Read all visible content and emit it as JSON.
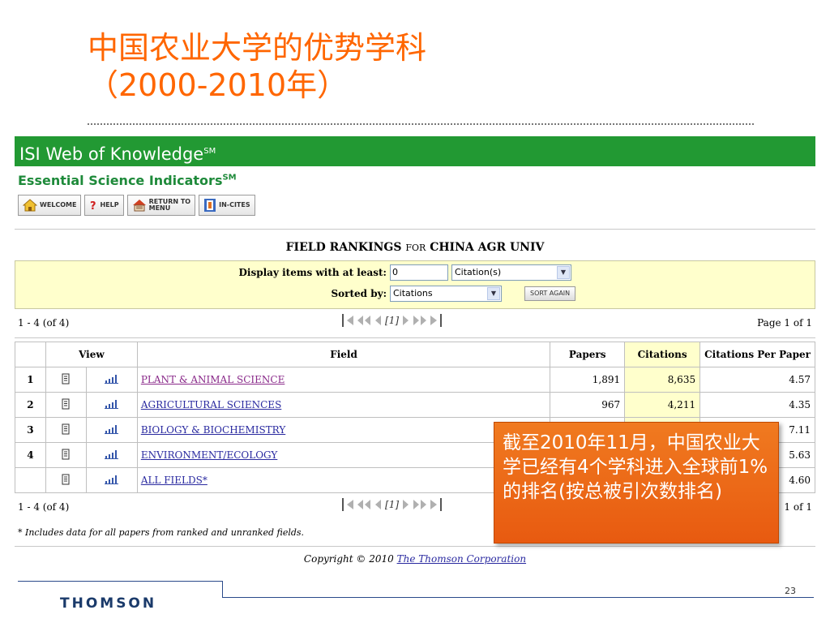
{
  "slide": {
    "title_line1": "中国农业大学的优势学科",
    "title_line2": "（2000-2010年）",
    "page_number": "23",
    "logo_text": "THOMSON"
  },
  "header": {
    "product_name": "ISI Web of Knowledge",
    "product_mark": "SM",
    "subtitle": "Essential Science Indicators",
    "subtitle_mark": "SM"
  },
  "nav": [
    {
      "label": "WELCOME",
      "icon": "home-icon"
    },
    {
      "label": "HELP",
      "icon": "help-icon"
    },
    {
      "label": "RETURN TO\nMENU",
      "icon": "menu-icon"
    },
    {
      "label": "IN-CITES",
      "icon": "in-cites-icon"
    }
  ],
  "rankings": {
    "heading_main": "FIELD RANKINGS",
    "heading_for": "FOR",
    "heading_inst": "CHINA AGR UNIV"
  },
  "filter": {
    "display_label": "Display items with at least:",
    "min_value": "0",
    "unit_selected": "Citation(s)",
    "sorted_label": "Sorted by:",
    "sort_selected": "Citations",
    "sort_button": "SORT AGAIN"
  },
  "pager": {
    "range": "1 - 4 (of 4)",
    "current_page": "1",
    "page_info": "Page 1 of 1"
  },
  "table": {
    "headers": {
      "view": "View",
      "field": "Field",
      "papers": "Papers",
      "citations": "Citations",
      "cpp": "Citations Per Paper"
    },
    "rows": [
      {
        "rank": "1",
        "field": "PLANT & ANIMAL SCIENCE",
        "papers": "1,891",
        "citations": "8,635",
        "cpp": "4.57",
        "visited": true
      },
      {
        "rank": "2",
        "field": "AGRICULTURAL SCIENCES",
        "papers": "967",
        "citations": "4,211",
        "cpp": "4.35",
        "visited": false
      },
      {
        "rank": "3",
        "field": "BIOLOGY & BIOCHEMISTRY",
        "papers": "",
        "citations": "",
        "cpp": "7.11",
        "visited": false
      },
      {
        "rank": "4",
        "field": "ENVIRONMENT/ECOLOGY",
        "papers": "",
        "citations": "",
        "cpp": "5.63",
        "visited": false
      },
      {
        "rank": "",
        "field": "ALL FIELDS*",
        "papers": "",
        "citations": "",
        "cpp": "4.60",
        "visited": false
      }
    ]
  },
  "bottom_pager": {
    "range": "1 - 4 (of 4)",
    "current_page": "1",
    "page_info_partial": "1 of 1"
  },
  "footnote": "* Includes data for all papers from ranked and unranked fields.",
  "copyright": {
    "text": "Copyright © 2010",
    "link": "The Thomson Corporation"
  },
  "callout": {
    "text": "截至2010年11月，中国农业大学已经有4个学科进入全球前1%的排名(按总被引次数排名)"
  },
  "colors": {
    "title_orange": "#ff6600",
    "isi_green": "#229933",
    "esi_green": "#1e8a3a",
    "highlight_yellow": "#ffffcc",
    "callout_orange": "#e85a10"
  }
}
